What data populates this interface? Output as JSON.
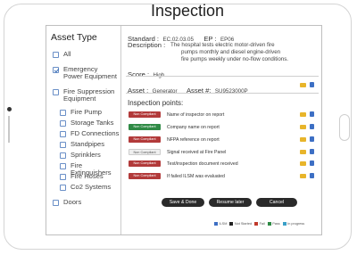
{
  "page_title": "Inspection",
  "sidebar": {
    "heading": "Asset Type",
    "items": [
      {
        "label": "All",
        "checked": false
      },
      {
        "label": "Emergency Power Equipment",
        "checked": true
      },
      {
        "label": "Fire Suppression Equipment",
        "checked": false
      },
      {
        "label": "Fire Pump",
        "checked": false
      },
      {
        "label": "Storage Tanks",
        "checked": false
      },
      {
        "label": "FD Connections",
        "checked": false
      },
      {
        "label": "Standpipes",
        "checked": false
      },
      {
        "label": "Sprinklers",
        "checked": false
      },
      {
        "label": "Fire Extinguishers",
        "checked": false
      },
      {
        "label": "Fire Hoses",
        "checked": false
      },
      {
        "label": "Co2 Systems",
        "checked": false
      },
      {
        "label": "Doors",
        "checked": false
      }
    ]
  },
  "standard": {
    "label": "Standard :",
    "value": "EC.02.03.05",
    "ep_label": "EP :",
    "ep_value": "EP06",
    "description_label": "Description :",
    "description_lines": [
      "The hospital tests electric motor-driven fire",
      "pumps monthly and diesel engine-driven",
      "fire pumps weekly under no-flow conditions."
    ],
    "score_label": "Score :",
    "score_value": "High"
  },
  "asset": {
    "label": "Asset :",
    "value": "Generator",
    "number_label": "Asset #:",
    "number_value": "SU9523000P"
  },
  "inspection": {
    "heading": "Inspection points:",
    "points": [
      {
        "status": "Non Compliant",
        "color": "red",
        "label": "Name of inspector on report"
      },
      {
        "status": "Non Compliant",
        "color": "green",
        "label": "Company name on report"
      },
      {
        "status": "Non Compliant",
        "color": "red",
        "label": "NFPA reference on report"
      },
      {
        "status": "Non Compliant",
        "color": "grey",
        "label": "Signal received at Fire Panel"
      },
      {
        "status": "Non Compliant",
        "color": "red",
        "label": "Test/inspection document received"
      },
      {
        "status": "Non Compliant",
        "color": "red",
        "label": "If failed ILSM was evaluated"
      }
    ]
  },
  "buttons": {
    "save": "Save & Done",
    "resume": "Resume later",
    "cancel": "Cancel"
  },
  "legend": [
    {
      "label": "ILSM",
      "color": "#3d6fc4"
    },
    {
      "label": "Not Started",
      "color": "#222222"
    },
    {
      "label": "Fail",
      "color": "#c0392b"
    },
    {
      "label": "Pass",
      "color": "#2f8a45"
    },
    {
      "label": "In progress",
      "color": "#3aa0c8"
    }
  ],
  "colors": {
    "fail": "#b23a3a",
    "pass": "#2f8a45",
    "neutral": "#efefef",
    "icon_camera": "#e8b52b",
    "icon_document": "#3d6fc4"
  }
}
